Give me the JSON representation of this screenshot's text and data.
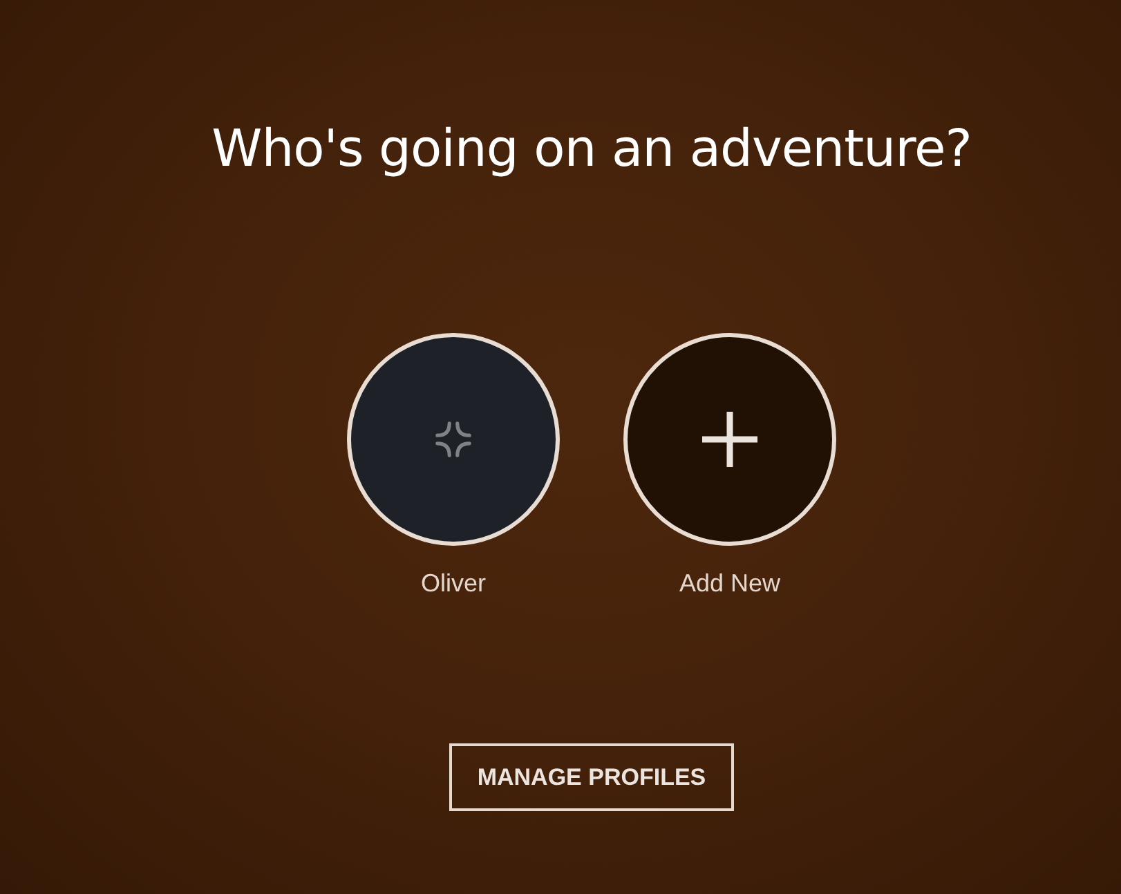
{
  "heading": "Who's going on an adventure?",
  "profiles": [
    {
      "kind": "user",
      "name": "Oliver"
    },
    {
      "kind": "add",
      "name": "Add New"
    }
  ],
  "manage_button": "MANAGE PROFILES"
}
